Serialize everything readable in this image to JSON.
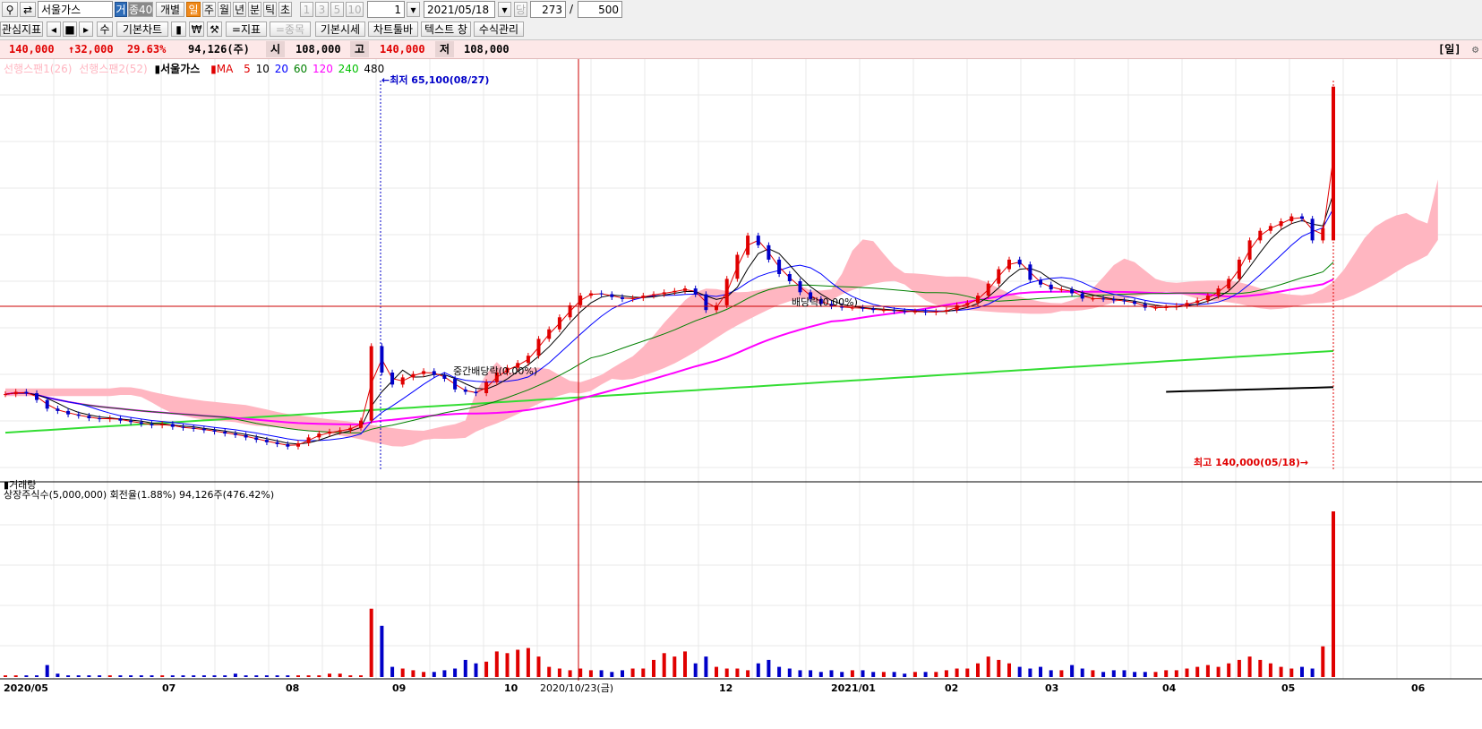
{
  "toolbar": {
    "stock_name": "서울가스",
    "tab_labels": [
      "거",
      "종40"
    ],
    "period_buttons": [
      "개별",
      "일",
      "주",
      "월",
      "년",
      "분",
      "틱",
      "초"
    ],
    "num_buttons": [
      "1",
      "3",
      "5",
      "10"
    ],
    "spin_value": "1",
    "date_value": "2021/05/18",
    "dang_label": "당",
    "count_value": "273",
    "slash": "/",
    "total_value": "500",
    "row2": [
      "관심지표",
      "기본차트",
      "지표",
      "종목",
      "기본시세",
      "차트툴바",
      "텍스트 창",
      "수식관리"
    ],
    "su_label": "수"
  },
  "quote": {
    "price": "140,000",
    "change": "↑32,000",
    "rate": "29.63%",
    "volume": "94,126(주)",
    "open_label": "시",
    "open": "108,000",
    "high_label": "고",
    "high": "140,000",
    "low_label": "저",
    "low": "108,000",
    "period_tag": "[일]"
  },
  "legend": {
    "span1": "선행스팬1(26)",
    "span2": "선행스팬2(52)",
    "name": "서울가스",
    "ma_label": "MA",
    "ma_periods": [
      "5",
      "10",
      "20",
      "60",
      "120",
      "240",
      "480"
    ],
    "ma_colors": [
      "#e00000",
      "#000000",
      "#0000ff",
      "#008000",
      "#ff00ff",
      "#00c000",
      "#000000"
    ]
  },
  "annotations": {
    "low_mark": "←최저 65,100(08/27)",
    "high_mark": "최고 140,000(05/18)→",
    "div1": "중간배당락(0.00%)",
    "div2": "배당락(0.00%)"
  },
  "volume_panel": {
    "title": "거래량",
    "info": "상장주식수(5,000,000) 회전율(1.88%) 94,126주(476.42%)"
  },
  "xaxis": {
    "labels": [
      "2020/05",
      "07",
      "08",
      "09",
      "10",
      "12",
      "2021/01",
      "02",
      "03",
      "04",
      "05",
      "06"
    ],
    "cursor_date": "2020/10/23(금)"
  },
  "colors": {
    "up": "#e00000",
    "down": "#0000c8",
    "cloud": "#ffb6c1"
  },
  "chart_data": {
    "type": "candlestick",
    "title": "서울가스",
    "period": "daily",
    "start": "2020/05",
    "end": "2021/05/18",
    "last_candle": {
      "open": 108000,
      "high": 140000,
      "low": 108000,
      "close": 140000,
      "volume": 94126
    },
    "min": {
      "value": 65100,
      "date": "08/27"
    },
    "max": {
      "value": 140000,
      "date": "05/18"
    },
    "close_series": [
      76000,
      76500,
      76200,
      74800,
      73000,
      72500,
      71800,
      71500,
      71000,
      70800,
      71000,
      70500,
      70200,
      69800,
      69500,
      69800,
      69200,
      69000,
      68800,
      68500,
      68200,
      67800,
      67500,
      67000,
      66500,
      66000,
      65600,
      65100,
      65800,
      67000,
      67800,
      68200,
      68500,
      69000,
      70500,
      86000,
      80500,
      78000,
      79500,
      80200,
      80800,
      80000,
      79200,
      77000,
      76500,
      76200,
      78500,
      80500,
      81500,
      82500,
      84000,
      87500,
      89500,
      92000,
      94500,
      96500,
      97000,
      96800,
      96200,
      95800,
      96000,
      96500,
      96800,
      97200,
      97500,
      98000,
      96800,
      93500,
      94500,
      100000,
      105000,
      109000,
      107000,
      104000,
      101000,
      99500,
      97200,
      95800,
      94800,
      94300,
      94000,
      94000,
      93800,
      93500,
      93500,
      93300,
      93200,
      93200,
      93000,
      93200,
      93500,
      94500,
      95000,
      96500,
      99000,
      102000,
      104000,
      103000,
      99800,
      98800,
      97800,
      97800,
      97000,
      95900,
      95900,
      95800,
      95500,
      95300,
      94800,
      94000,
      94000,
      94100,
      94400,
      95000,
      95500,
      96500,
      98000,
      100000,
      104000,
      108000,
      110000,
      111000,
      112000,
      113000,
      112500,
      108000,
      110500,
      140000
    ],
    "volume_series": [
      1,
      1,
      1,
      1,
      7,
      2,
      1,
      1,
      1,
      1,
      1,
      1,
      1,
      1,
      1,
      1,
      1,
      1,
      1,
      1,
      1,
      1,
      2,
      1,
      1,
      1,
      1,
      1,
      1,
      1,
      1,
      2,
      2,
      1,
      1,
      40,
      30,
      6,
      5,
      4,
      3,
      3,
      4,
      5,
      10,
      8,
      9,
      15,
      14,
      16,
      17,
      12,
      6,
      5,
      4,
      5,
      4,
      4,
      3,
      4,
      5,
      5,
      10,
      14,
      12,
      15,
      8,
      12,
      6,
      5,
      5,
      4,
      8,
      10,
      6,
      5,
      4,
      4,
      3,
      4,
      3,
      4,
      4,
      3,
      3,
      3,
      2,
      3,
      3,
      3,
      4,
      5,
      5,
      8,
      12,
      10,
      8,
      6,
      5,
      6,
      4,
      4,
      7,
      5,
      4,
      3,
      4,
      4,
      3,
      3,
      3,
      4,
      4,
      5,
      6,
      7,
      6,
      8,
      10,
      12,
      10,
      8,
      6,
      5,
      6,
      5,
      18,
      97
    ]
  }
}
